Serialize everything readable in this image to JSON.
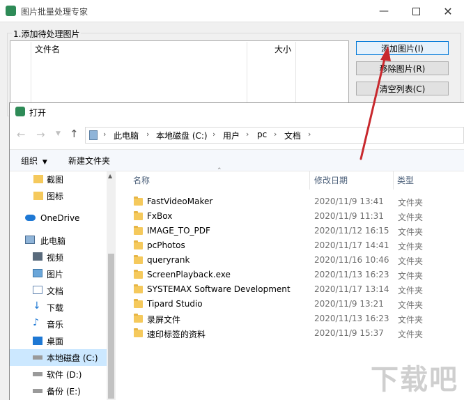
{
  "main_window": {
    "title": "图片批量处理专家",
    "group_label": "1.添加待处理图片",
    "columns": [
      "文件名",
      "大小"
    ],
    "buttons": {
      "add": "添加图片(I)",
      "remove": "移除图片(R)",
      "clear": "清空列表(C)"
    }
  },
  "dialog": {
    "title": "打开",
    "breadcrumb": [
      "此电脑",
      "本地磁盘 (C:)",
      "用户",
      "pc",
      "文档"
    ],
    "toolbar": {
      "organize": "组织",
      "new_folder": "新建文件夹"
    },
    "nav": [
      {
        "label": "截图",
        "icon": "folder-icon"
      },
      {
        "label": "图标",
        "icon": "folder-icon"
      },
      {
        "label": "OneDrive",
        "icon": "cloud-icon"
      },
      {
        "label": "此电脑",
        "icon": "computer-icon"
      },
      {
        "label": "视频",
        "icon": "video-icon"
      },
      {
        "label": "图片",
        "icon": "picture-icon"
      },
      {
        "label": "文档",
        "icon": "document-icon"
      },
      {
        "label": "下载",
        "icon": "download-icon"
      },
      {
        "label": "音乐",
        "icon": "music-icon"
      },
      {
        "label": "桌面",
        "icon": "desktop-icon"
      },
      {
        "label": "本地磁盘 (C:)",
        "icon": "drive-icon"
      },
      {
        "label": "软件 (D:)",
        "icon": "drive-icon"
      },
      {
        "label": "备份 (E:)",
        "icon": "drive-icon"
      }
    ],
    "columns": {
      "name": "名称",
      "date": "修改日期",
      "type": "类型"
    },
    "files": [
      {
        "name": "FastVideoMaker",
        "date": "2020/11/9 13:41",
        "type": "文件夹"
      },
      {
        "name": "FxBox",
        "date": "2020/11/9 11:31",
        "type": "文件夹"
      },
      {
        "name": "IMAGE_TO_PDF",
        "date": "2020/11/12 16:15",
        "type": "文件夹"
      },
      {
        "name": "pcPhotos",
        "date": "2020/11/17 14:41",
        "type": "文件夹"
      },
      {
        "name": "queryrank",
        "date": "2020/11/16 10:46",
        "type": "文件夹"
      },
      {
        "name": "ScreenPlayback.exe",
        "date": "2020/11/13 16:23",
        "type": "文件夹"
      },
      {
        "name": "SYSTEMAX Software Development",
        "date": "2020/11/17 13:14",
        "type": "文件夹"
      },
      {
        "name": "Tipard Studio",
        "date": "2020/11/9 13:21",
        "type": "文件夹"
      },
      {
        "name": "录屏文件",
        "date": "2020/11/13 16:23",
        "type": "文件夹"
      },
      {
        "name": "速印标签的资料",
        "date": "2020/11/9 15:37",
        "type": "文件夹"
      }
    ]
  },
  "colors": {
    "accent": "#cce8ff",
    "annotation": "#c8282d",
    "folder": "#f5c95c"
  }
}
